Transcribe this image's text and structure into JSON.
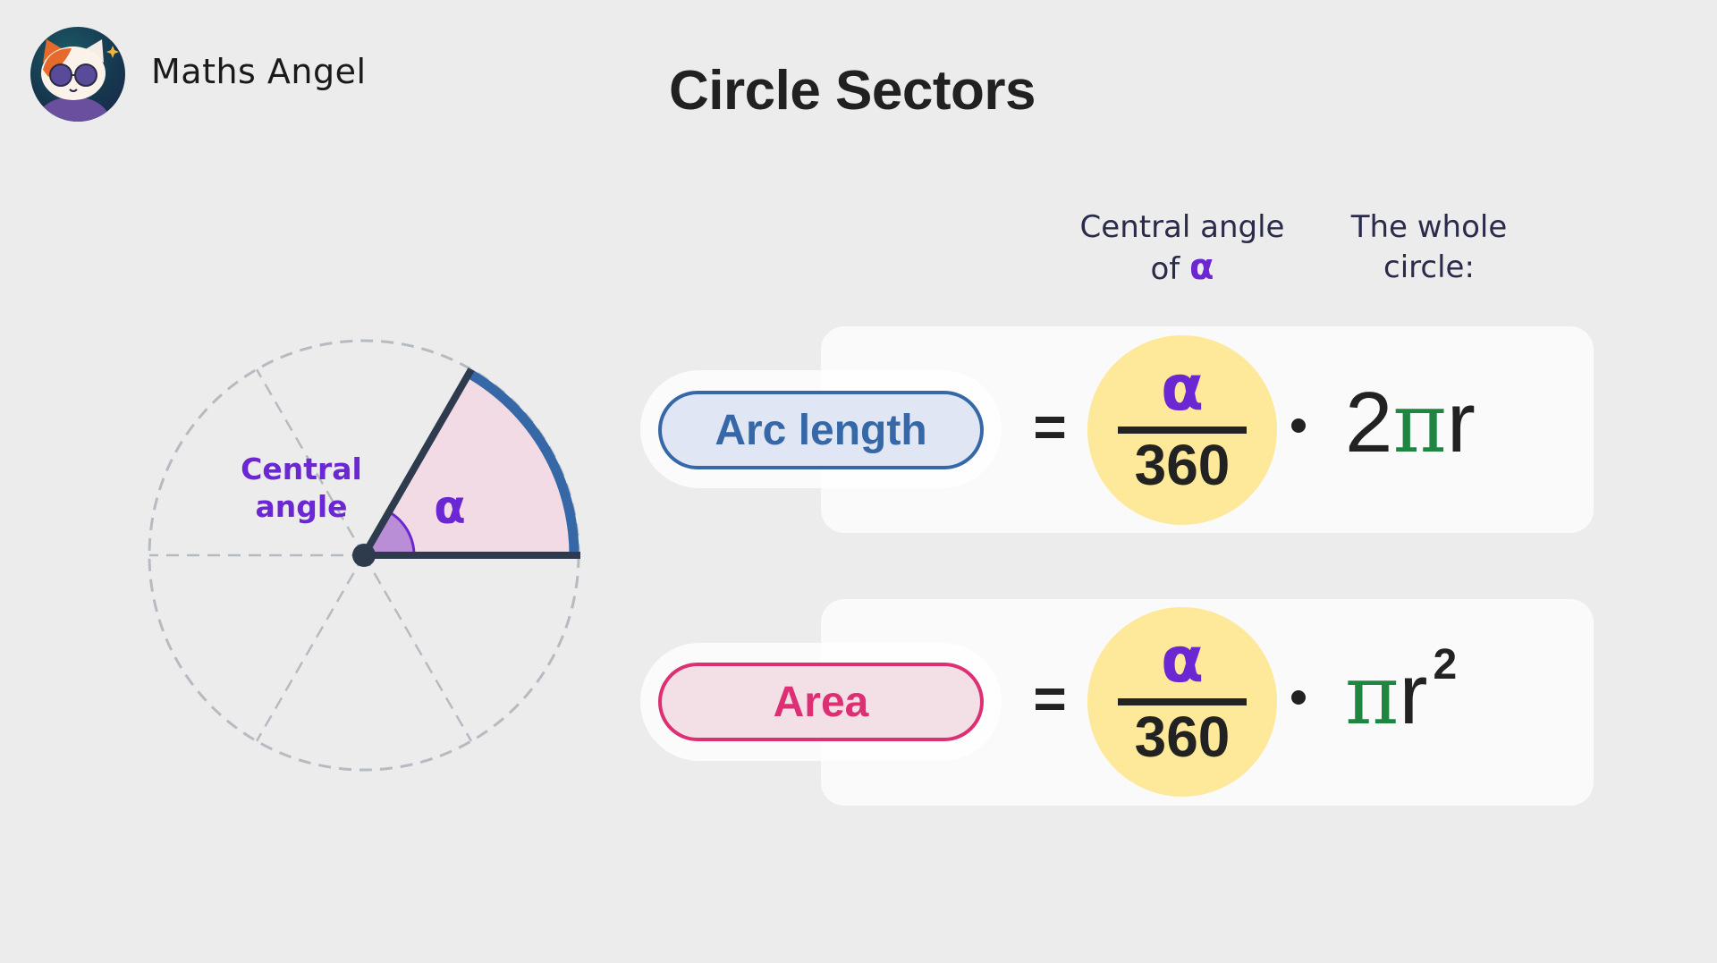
{
  "brand": {
    "name": "Maths Angel",
    "logo_icon": "cat-with-sunglasses-avatar"
  },
  "title": "Circle Sectors",
  "headers": {
    "central_angle_line1": "Central angle",
    "central_angle_line2": "of",
    "central_angle_symbol": "α",
    "whole_circle_line1": "The whole",
    "whole_circle_line2": "circle:"
  },
  "diagram": {
    "label_line1": "Central",
    "label_line2": "angle",
    "angle_symbol": "α",
    "sector_angle_degrees": 60,
    "divisions": 6,
    "colors": {
      "sector_fill": "#f2dbe4",
      "arc": "#3668a8",
      "radius": "#2e3b4e",
      "angle_mark": "#b98ed6",
      "angle_mark_stroke": "#6b28d2",
      "label": "#6b28d2",
      "dashed": "#b6bbc2"
    }
  },
  "formulas": [
    {
      "label": "Arc length",
      "equals": "=",
      "numerator": "α",
      "denominator": "360",
      "times": "·",
      "expression_prefix": "2",
      "pi": "π",
      "expression_suffix": "r",
      "exponent": "",
      "color": "#3668a8"
    },
    {
      "label": "Area",
      "equals": "=",
      "numerator": "α",
      "denominator": "360",
      "times": "·",
      "expression_prefix": "",
      "pi": "π",
      "expression_suffix": "r",
      "exponent": "2",
      "color": "#dc2f74"
    }
  ]
}
